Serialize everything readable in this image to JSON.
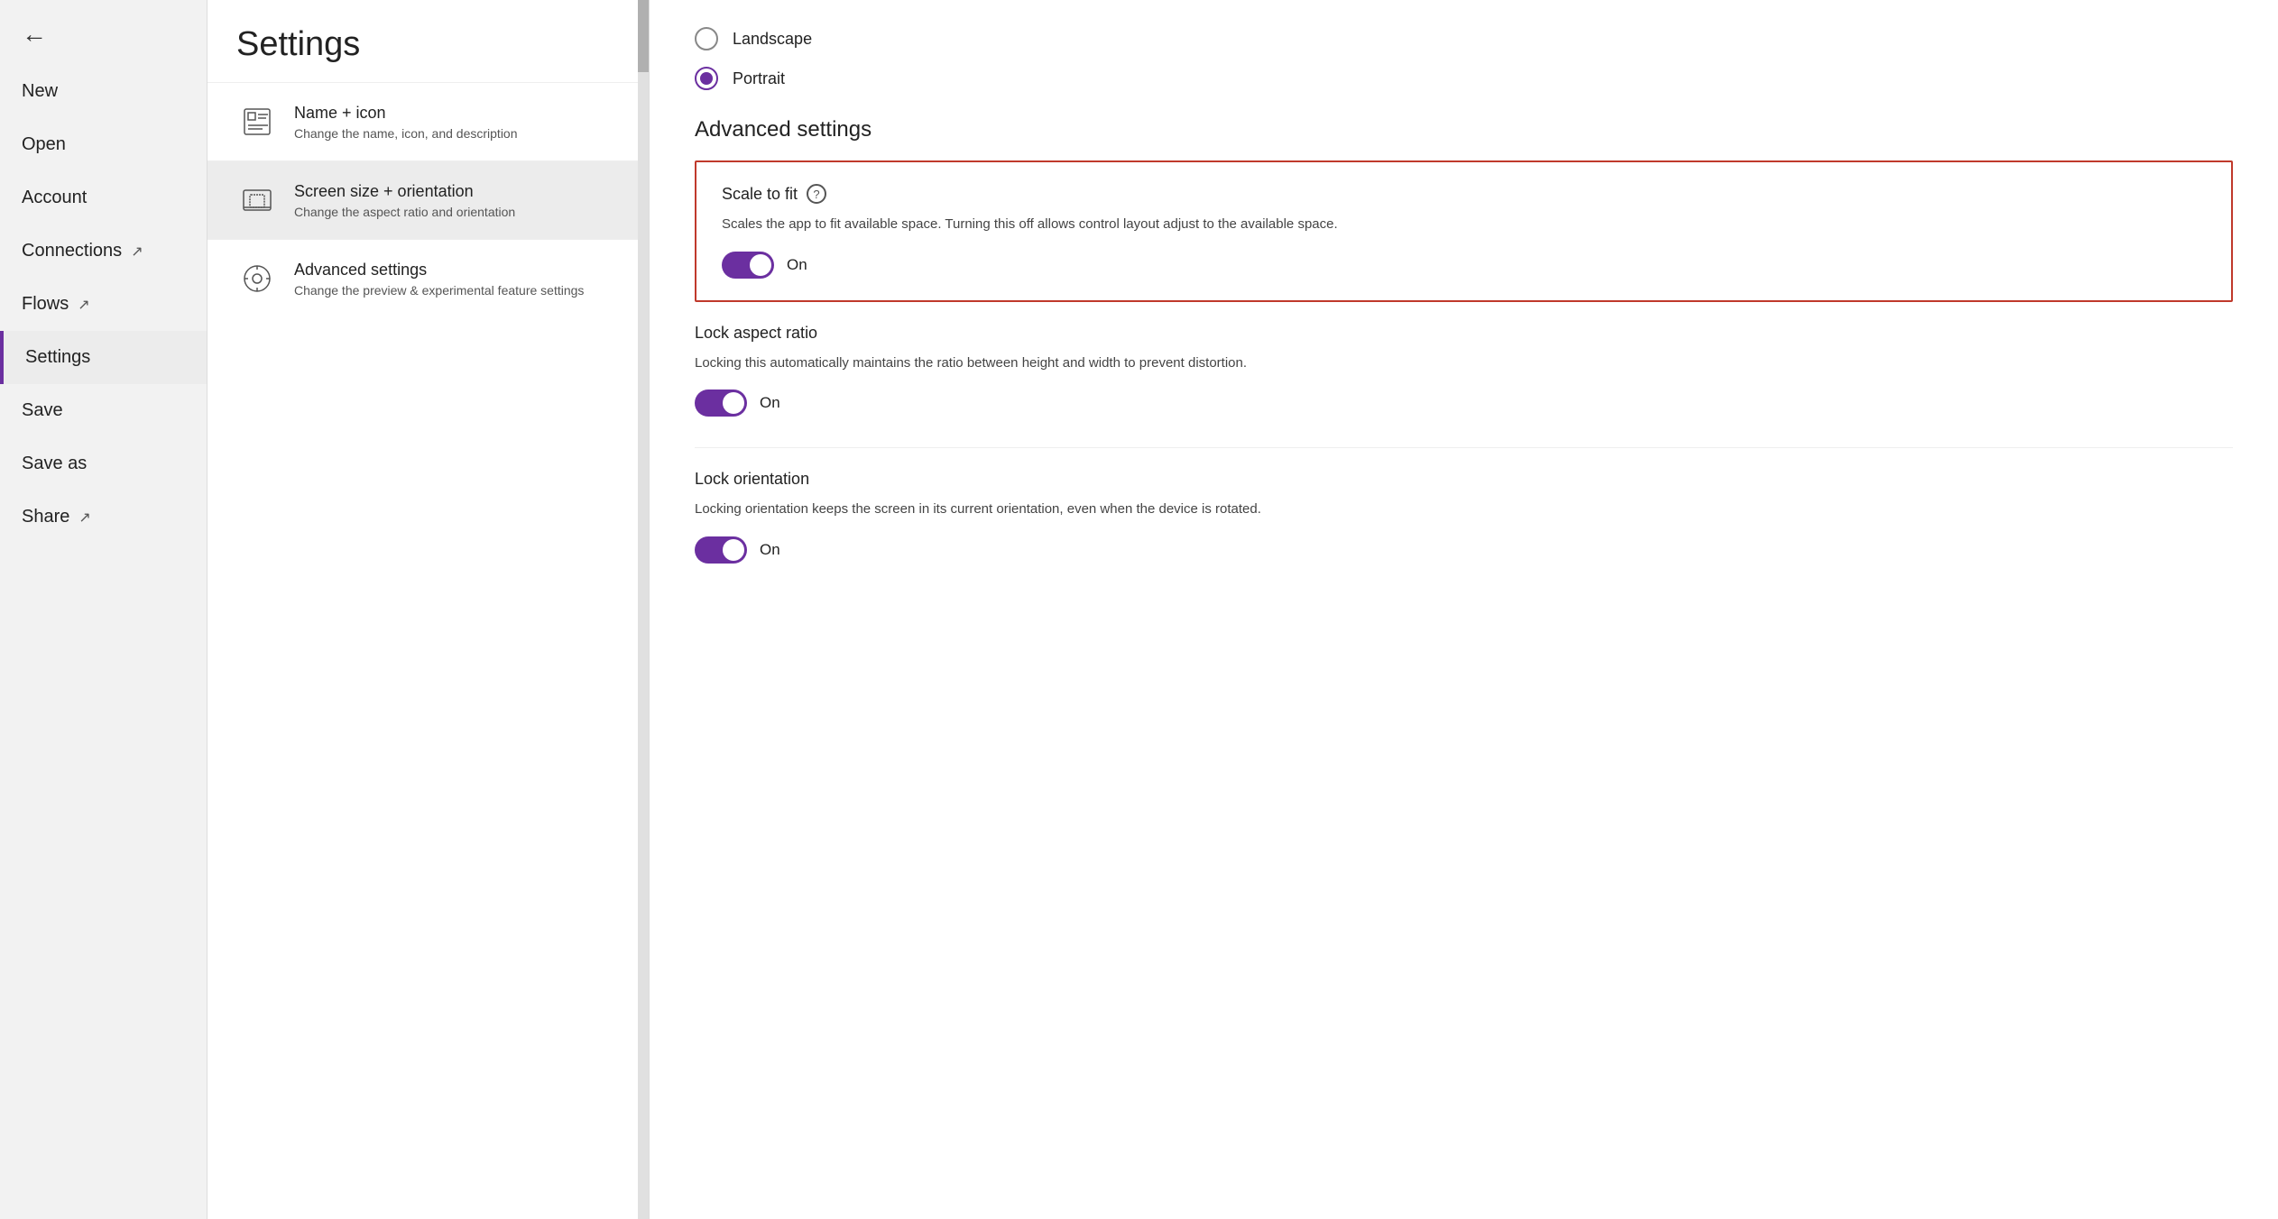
{
  "sidebar": {
    "back_label": "←",
    "items": [
      {
        "id": "new",
        "label": "New",
        "external": false,
        "active": false
      },
      {
        "id": "open",
        "label": "Open",
        "external": false,
        "active": false
      },
      {
        "id": "account",
        "label": "Account",
        "external": false,
        "active": false
      },
      {
        "id": "connections",
        "label": "Connections",
        "external": true,
        "active": false
      },
      {
        "id": "flows",
        "label": "Flows",
        "external": true,
        "active": false
      },
      {
        "id": "settings",
        "label": "Settings",
        "external": false,
        "active": true
      },
      {
        "id": "save",
        "label": "Save",
        "external": false,
        "active": false
      },
      {
        "id": "save-as",
        "label": "Save as",
        "external": false,
        "active": false
      },
      {
        "id": "share",
        "label": "Share",
        "external": true,
        "active": false
      }
    ]
  },
  "middle": {
    "title": "Settings",
    "menu_items": [
      {
        "id": "name-icon",
        "title": "Name + icon",
        "description": "Change the name, icon, and description",
        "active": false
      },
      {
        "id": "screen-size",
        "title": "Screen size + orientation",
        "description": "Change the aspect ratio and orientation",
        "active": true
      },
      {
        "id": "advanced-settings",
        "title": "Advanced settings",
        "description": "Change the preview & experimental feature settings",
        "active": false
      }
    ]
  },
  "content": {
    "orientation": {
      "options": [
        {
          "id": "landscape",
          "label": "Landscape",
          "selected": false
        },
        {
          "id": "portrait",
          "label": "Portrait",
          "selected": true
        }
      ]
    },
    "advanced_settings_title": "Advanced settings",
    "settings": [
      {
        "id": "scale-to-fit",
        "name": "Scale to fit",
        "has_help": true,
        "description": "Scales the app to fit available space. Turning this off allows control layout adjust to the available space.",
        "toggle_on": true,
        "toggle_label": "On",
        "highlighted": true
      },
      {
        "id": "lock-aspect-ratio",
        "name": "Lock aspect ratio",
        "has_help": false,
        "description": "Locking this automatically maintains the ratio between height and width to prevent distortion.",
        "toggle_on": true,
        "toggle_label": "On",
        "highlighted": false
      },
      {
        "id": "lock-orientation",
        "name": "Lock orientation",
        "has_help": false,
        "description": "Locking orientation keeps the screen in its current orientation, even when the device is rotated.",
        "toggle_on": true,
        "toggle_label": "On",
        "highlighted": false
      }
    ]
  }
}
